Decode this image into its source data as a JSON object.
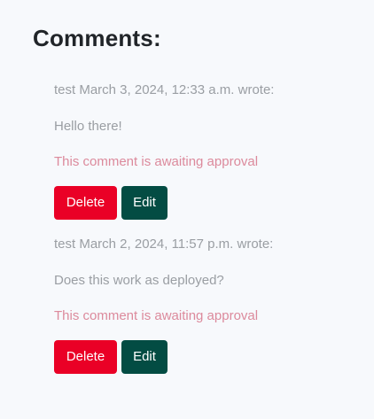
{
  "comments_section": {
    "title": "Comments:"
  },
  "comments": [
    {
      "meta": "test March 3, 2024, 12:33 a.m. wrote:",
      "body": "Hello there!",
      "status": "This comment is awaiting approval",
      "delete_label": "Delete",
      "edit_label": "Edit"
    },
    {
      "meta": "test March 2, 2024, 11:57 p.m. wrote:",
      "body": "Does this work as deployed?",
      "status": "This comment is awaiting approval",
      "delete_label": "Delete",
      "edit_label": "Edit"
    }
  ],
  "colors": {
    "background": "#f7f9fc",
    "heading_text": "#212529",
    "muted_text": "#9a9ea3",
    "pending_text": "#dc8a9c",
    "delete_button": "#ea0026",
    "edit_button": "#034c43"
  }
}
